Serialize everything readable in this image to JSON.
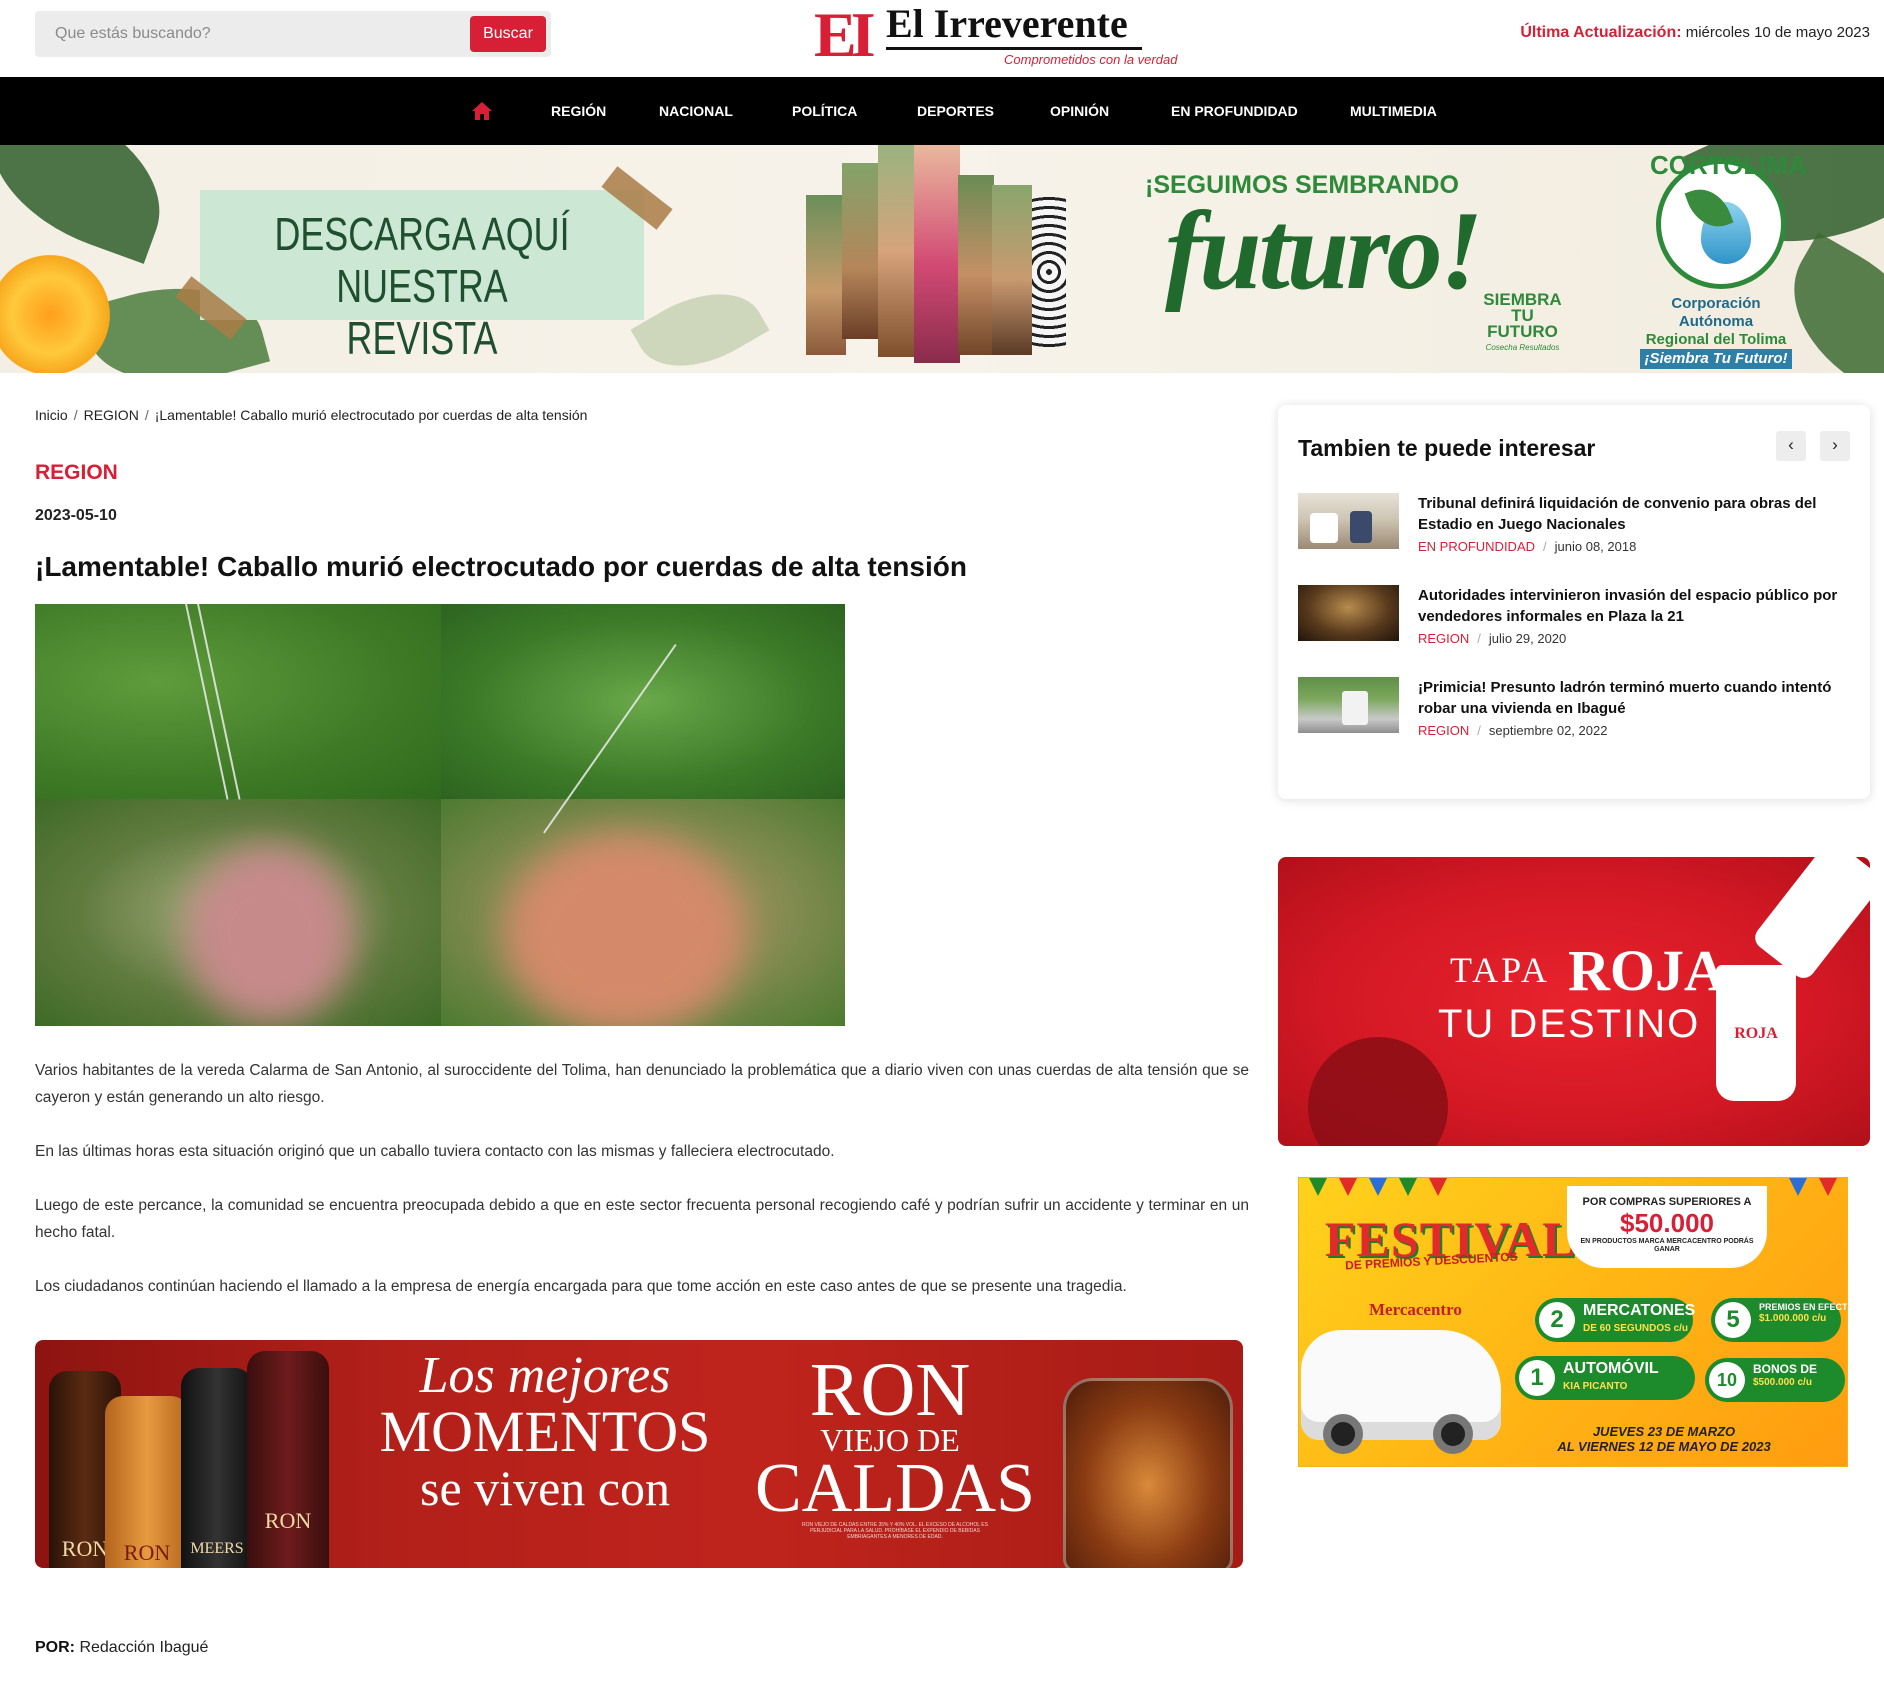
{
  "header": {
    "search_placeholder": "Que estás buscando?",
    "search_button": "Buscar",
    "logo_mark": "EI",
    "logo_name": "El Irreverente",
    "logo_tagline": "Comprometidos con la verdad",
    "update_label": "Última Actualización:",
    "update_date": "miércoles 10 de mayo 2023"
  },
  "nav": {
    "home_icon": "home-icon",
    "items": [
      "REGIÓN",
      "NACIONAL",
      "POLÍTICA",
      "DEPORTES",
      "OPINIÓN",
      "EN PROFUNDIDAD",
      "MULTIMEDIA"
    ]
  },
  "top_banner": {
    "card_line1": "DESCARGA AQUÍ NUESTRA",
    "card_line2": "REVISTA INTERACTIVA",
    "headline": "¡SEGUIMOS SEMBRANDO",
    "headline_big": "futuro!",
    "siembra_line1": "SIEMBRA",
    "siembra_line2": "TU FUTURO",
    "siembra_line3": "Cosecha Resultados",
    "brand_arc": "CORTOLIMA",
    "brand_line1": "Corporación Autónoma",
    "brand_line2": "Regional del Tolima",
    "brand_line3": "¡Siembra Tu Futuro!"
  },
  "breadcrumb": {
    "home": "Inicio",
    "section": "REGION",
    "current": "¡Lamentable! Caballo murió electrocutado por cuerdas de alta tensión"
  },
  "article": {
    "category": "REGION",
    "date": "2023-05-10",
    "title": "¡Lamentable! Caballo murió electrocutado por cuerdas de alta tensión",
    "paragraphs": [
      "Varios habitantes de la vereda Calarma de San Antonio, al suroccidente del Tolima, han denunciado la problemática que a diario viven con unas cuerdas de alta tensión que se cayeron y están generando un alto riesgo.",
      "En las últimas horas esta situación originó que un caballo tuviera contacto con las mismas y falleciera electrocutado.",
      "Luego de este percance, la comunidad se encuentra preocupada debido a que en este sector frecuenta personal recogiendo café y podrían sufrir un accidente y terminar en un hecho fatal.",
      "Los ciudadanos continúan haciendo el llamado a la empresa de energía encargada para que tome acción en este caso antes de que se presente una tragedia."
    ],
    "byline_label": "POR:",
    "byline_author": "Redacción Ibagué"
  },
  "ron_ad": {
    "script_line": "Los mejores",
    "momentos": "MOMENTOS",
    "viven": "se viven con",
    "title_1": "RON",
    "title_2": "VIEJO DE",
    "title_3": "CALDAS",
    "bottle_label_1": "RON",
    "bottle_label_2": "RON",
    "bottle_label_3": "MEERS",
    "bottle_label_4": "RON",
    "legal": "RON VIEJO DE CALDAS ENTRE 35% Y 40% VOL. EL EXCESO DE ALCOHOL ES PERJUDICIAL PARA LA SALUD. PROHÍBASE EL EXPENDIO DE BEBIDAS EMBRIAGANTES A MENORES DE EDAD."
  },
  "related": {
    "title": "Tambien te puede interesar",
    "prev": "‹",
    "next": "›",
    "items": [
      {
        "title": "Tribunal definirá liquidación de convenio para obras del Estadio en Juego Nacionales",
        "category": "EN PROFUNDIDAD",
        "date": "junio 08, 2018"
      },
      {
        "title": "Autoridades intervinieron invasión del espacio público por vendedores informales en Plaza la 21",
        "category": "REGION",
        "date": "julio 29, 2020"
      },
      {
        "title": "¡Primicia! Presunto ladrón terminó muerto cuando intentó robar una vivienda en Ibagué",
        "category": "REGION",
        "date": "septiembre 02, 2022"
      }
    ],
    "separator": "/"
  },
  "tapa_ad": {
    "line1": "TAPA",
    "line1_bold": "ROJA",
    "line2": "TU DESTINO",
    "cup_label": "ROJA"
  },
  "festival_ad": {
    "title": "FESTIVAL",
    "subtitle": "DE PREMIOS Y DESCUENTOS",
    "box_line1": "POR COMPRAS SUPERIORES A",
    "box_amount": "$50.000",
    "box_line3": "EN PRODUCTOS MARCA MERCACENTRO PODRÁS GANAR",
    "brand": "Mercacentro",
    "prize1_num": "2",
    "prize1_label": "MERCATONES",
    "prize1_sub": "DE 60 SEGUNDOS c/u",
    "prize2_num": "1",
    "prize2_label": "AUTOMÓVIL",
    "prize2_sub": "KIA PICANTO",
    "prize3_num": "5",
    "prize3_label": "PREMIOS EN EFECTIVO DE",
    "prize3_sub": "$1.000.000 c/u",
    "prize4_num": "10",
    "prize4_label": "BONOS DE",
    "prize4_sub": "$500.000 c/u",
    "dates_1": "JUEVES 23 DE MARZO",
    "dates_2": "AL VIERNES 12 DE MAYO DE 2023"
  },
  "colors": {
    "accent": "#d71f35",
    "nav_bg": "#000000",
    "text": "#222222"
  }
}
